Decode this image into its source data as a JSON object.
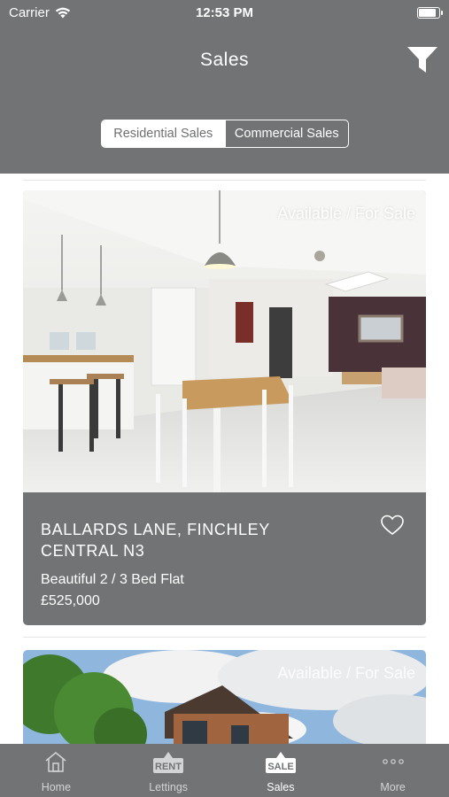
{
  "status_bar": {
    "carrier": "Carrier",
    "time": "12:53 PM",
    "battery_level": 0.9
  },
  "header": {
    "title": "Sales",
    "segments": [
      {
        "label": "Residential Sales",
        "active": true
      },
      {
        "label": "Commercial Sales",
        "active": false
      }
    ]
  },
  "listings": [
    {
      "status": "Available / For Sale",
      "address": "BALLARDS LANE, FINCHLEY CENTRAL N3",
      "description": "Beautiful 2 / 3 Bed Flat",
      "price": "£525,000",
      "favorited": false
    },
    {
      "status": "Available / For Sale"
    }
  ],
  "tabbar": {
    "items": [
      {
        "label": "Home",
        "icon": "home-icon",
        "active": false
      },
      {
        "label": "Lettings",
        "icon": "rent-sign-icon",
        "badge": "RENT",
        "active": false
      },
      {
        "label": "Sales",
        "icon": "sale-sign-icon",
        "badge": "SALE",
        "active": true
      },
      {
        "label": "More",
        "icon": "more-dots-icon",
        "active": false
      }
    ]
  },
  "colors": {
    "header_bg": "#717375",
    "card_info_bg": "#717375",
    "text": "#ffffff"
  }
}
